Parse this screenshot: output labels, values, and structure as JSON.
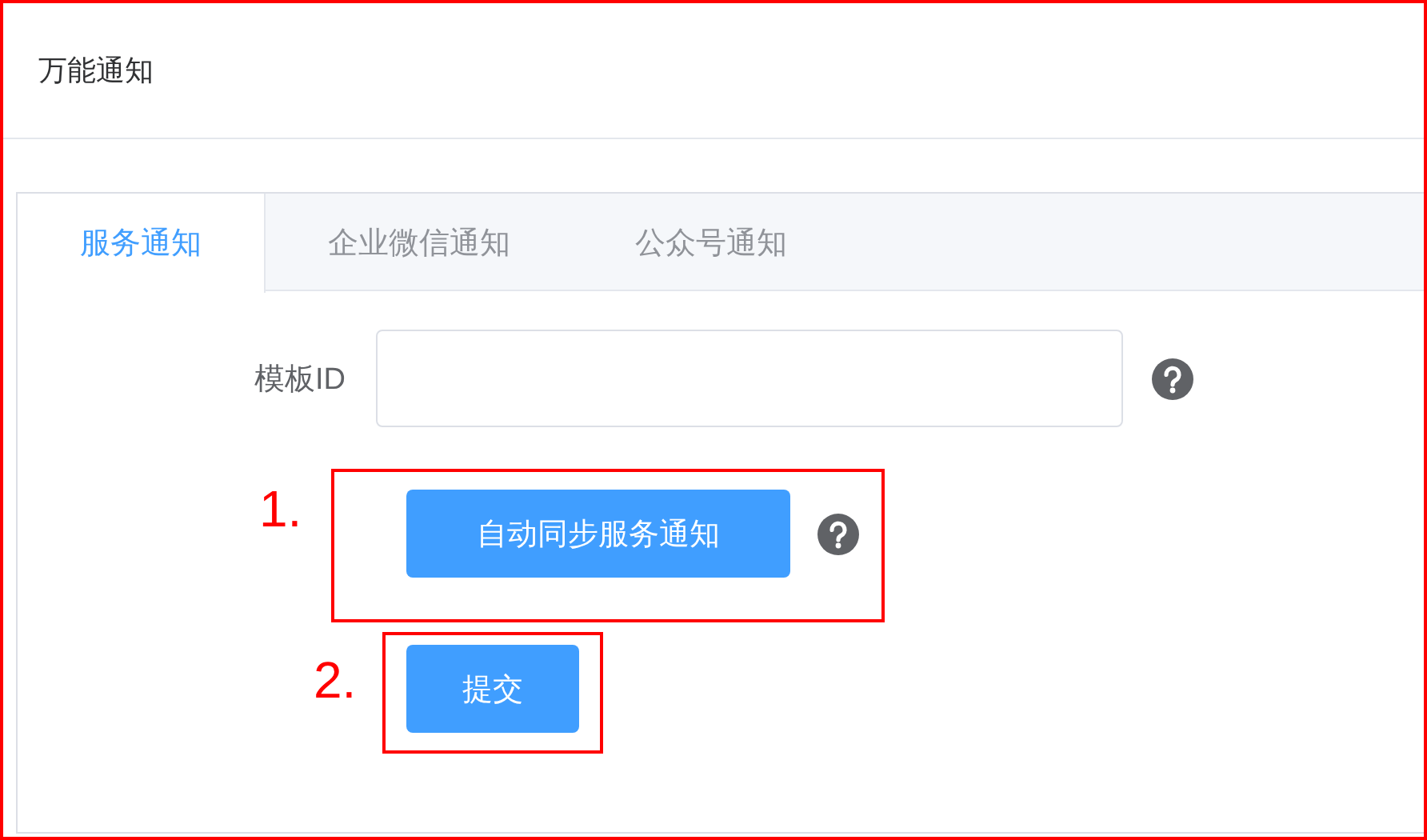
{
  "header": {
    "title": "万能通知"
  },
  "tabs": [
    {
      "label": "服务通知",
      "selected": true
    },
    {
      "label": "企业微信通知",
      "selected": false
    },
    {
      "label": "公众号通知",
      "selected": false
    }
  ],
  "form": {
    "field_label": "模板ID",
    "sync_button": "自动同步服务通知",
    "submit_button": "提交"
  },
  "annotations": [
    {
      "label": "1."
    },
    {
      "label": "2."
    }
  ]
}
